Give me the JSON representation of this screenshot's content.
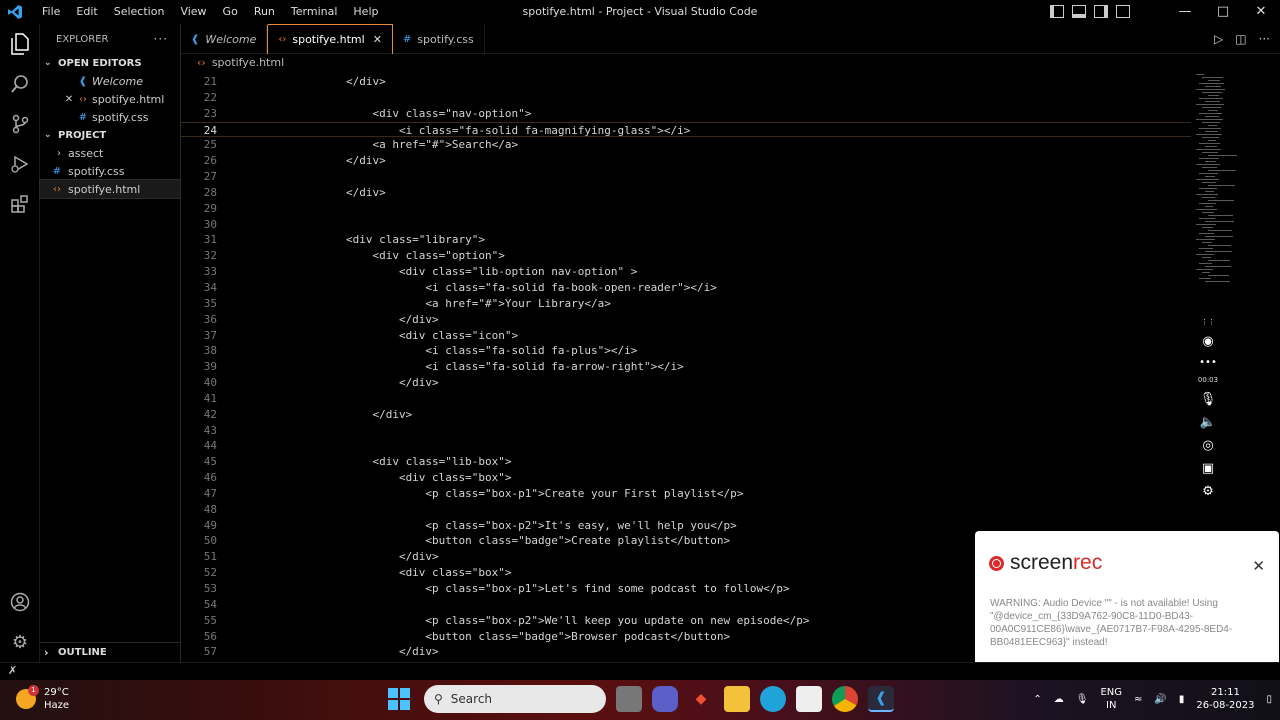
{
  "window": {
    "title": "spotifye.html - Project - Visual Studio Code",
    "menu": [
      "File",
      "Edit",
      "Selection",
      "View",
      "Go",
      "Run",
      "Terminal",
      "Help"
    ]
  },
  "sidebar": {
    "header": "EXPLORER",
    "open_editors_label": "OPEN EDITORS",
    "open_editors": [
      {
        "icon": "vscode-icon",
        "label": "Welcome",
        "italic": true
      },
      {
        "icon": "html-icon",
        "label": "spotifye.html",
        "close": "✕"
      },
      {
        "icon": "css-icon",
        "label": "spotify.css"
      }
    ],
    "project_label": "PROJECT",
    "project_items": [
      {
        "type": "folder",
        "label": "assect"
      },
      {
        "type": "css",
        "label": "spotify.css"
      },
      {
        "type": "html",
        "label": "spotifye.html"
      }
    ],
    "outline_label": "OUTLINE"
  },
  "tabs": [
    {
      "label": "Welcome",
      "icon": "vscode-icon",
      "active": false
    },
    {
      "label": "spotifye.html",
      "icon": "html-icon",
      "active": true
    },
    {
      "label": "spotify.css",
      "icon": "css-icon",
      "active": false
    }
  ],
  "breadcrumb": "spotifye.html",
  "editor": {
    "current_line": 24,
    "lines": [
      {
        "n": "21",
        "text": "                </div>"
      },
      {
        "n": "22",
        "text": ""
      },
      {
        "n": "23",
        "text": "                    <div class=\"nav-option\">"
      },
      {
        "n": "24",
        "text": "                        <i class=\"fa-solid fa-magnifying-glass\"></i>"
      },
      {
        "n": "25",
        "text": "                    <a href=\"#\">Search</a>"
      },
      {
        "n": "26",
        "text": "                </div>"
      },
      {
        "n": "27",
        "text": ""
      },
      {
        "n": "28",
        "text": "                </div>"
      },
      {
        "n": "29",
        "text": ""
      },
      {
        "n": "30",
        "text": ""
      },
      {
        "n": "31",
        "text": "                <div class=\"library\">"
      },
      {
        "n": "32",
        "text": "                    <div class=\"option\">"
      },
      {
        "n": "33",
        "text": "                        <div class=\"lib-option nav-option\" >"
      },
      {
        "n": "34",
        "text": "                            <i class=\"fa-solid fa-book-open-reader\"></i>"
      },
      {
        "n": "35",
        "text": "                            <a href=\"#\">Your Library</a>"
      },
      {
        "n": "36",
        "text": "                        </div>"
      },
      {
        "n": "37",
        "text": "                        <div class=\"icon\">"
      },
      {
        "n": "38",
        "text": "                            <i class=\"fa-solid fa-plus\"></i>"
      },
      {
        "n": "39",
        "text": "                            <i class=\"fa-solid fa-arrow-right\"></i>"
      },
      {
        "n": "40",
        "text": "                        </div>"
      },
      {
        "n": "41",
        "text": ""
      },
      {
        "n": "42",
        "text": "                    </div>"
      },
      {
        "n": "43",
        "text": ""
      },
      {
        "n": "44",
        "text": ""
      },
      {
        "n": "45",
        "text": "                    <div class=\"lib-box\">"
      },
      {
        "n": "46",
        "text": "                        <div class=\"box\">"
      },
      {
        "n": "47",
        "text": "                            <p class=\"box-p1\">Create your First playlist</p>"
      },
      {
        "n": "48",
        "text": ""
      },
      {
        "n": "49",
        "text": "                            <p class=\"box-p2\">It's easy, we'll help you</p>"
      },
      {
        "n": "50",
        "text": "                            <button class=\"badge\">Create playlist</button>"
      },
      {
        "n": "51",
        "text": "                        </div>"
      },
      {
        "n": "52",
        "text": "                        <div class=\"box\">"
      },
      {
        "n": "53",
        "text": "                            <p class=\"box-p1\">Let's find some podcast to follow</p>"
      },
      {
        "n": "54",
        "text": ""
      },
      {
        "n": "55",
        "text": "                            <p class=\"box-p2\">We'll keep you update on new episode</p>"
      },
      {
        "n": "56",
        "text": "                            <button class=\"badge\">Browser podcast</button>"
      },
      {
        "n": "57",
        "text": "                        </div>"
      }
    ]
  },
  "recorder": {
    "time": "00:03",
    "popup": {
      "brand_a": "screen",
      "brand_b": "rec",
      "warning": "WARNING: Audio Device \"\" - is not available! Using \"@device_cm_{33D9A762-90C8-11D0-BD43-00A0C911CE86}\\wave_{AE0717B7-F98A-4295-8ED4-BB0481EEC963}\" instead!"
    }
  },
  "status": {
    "left_icon": "remote-icon"
  },
  "taskbar": {
    "weather_temp": "29°C",
    "weather_desc": "Haze",
    "weather_badge": "1",
    "search_placeholder": "Search",
    "lang_top": "ENG",
    "lang_bottom": "IN",
    "time": "21:11",
    "date": "26-08-2023"
  },
  "colors": {
    "accent_tab": "#e38b3f",
    "vscode_blue": "#3a9ee8",
    "screenrec_red": "#d92b2b"
  }
}
